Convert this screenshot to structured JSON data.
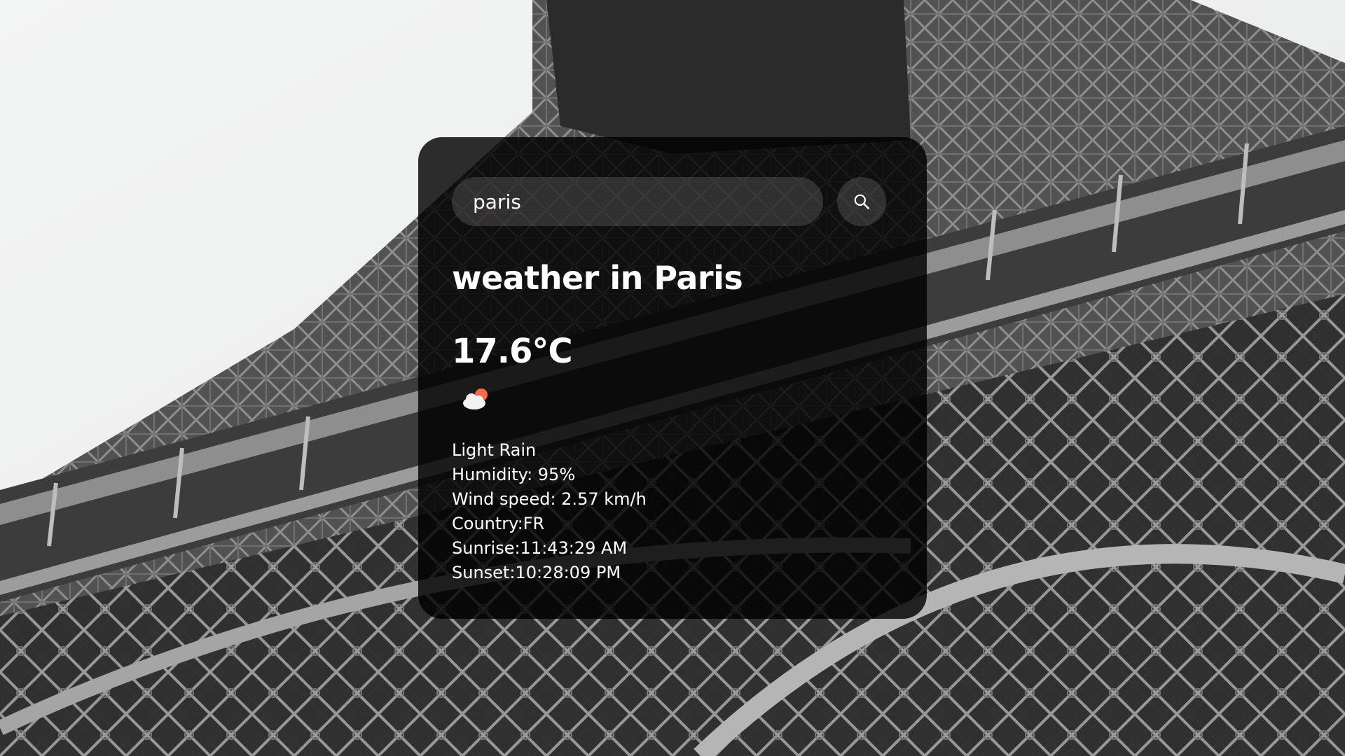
{
  "background": {
    "description_icon": "eiffel-tower-photo"
  },
  "search": {
    "value": "paris",
    "placeholder": "",
    "button_icon": "search-icon"
  },
  "weather": {
    "heading": "weather in Paris",
    "temperature": "17.6°C",
    "icon": "cloud-sun-rain-icon",
    "description": "Light Rain",
    "humidity": "Humidity: 95%",
    "wind": "Wind speed: 2.57 km/h",
    "country": "Country:FR",
    "sunrise": "Sunrise:11:43:29 AM",
    "sunset": "Sunset:10:28:09 PM"
  },
  "colors": {
    "card_bg": "#000000",
    "text": "#ffffff",
    "icon_sun": "#ff6b4a",
    "icon_cloud": "#f2f2f2"
  }
}
